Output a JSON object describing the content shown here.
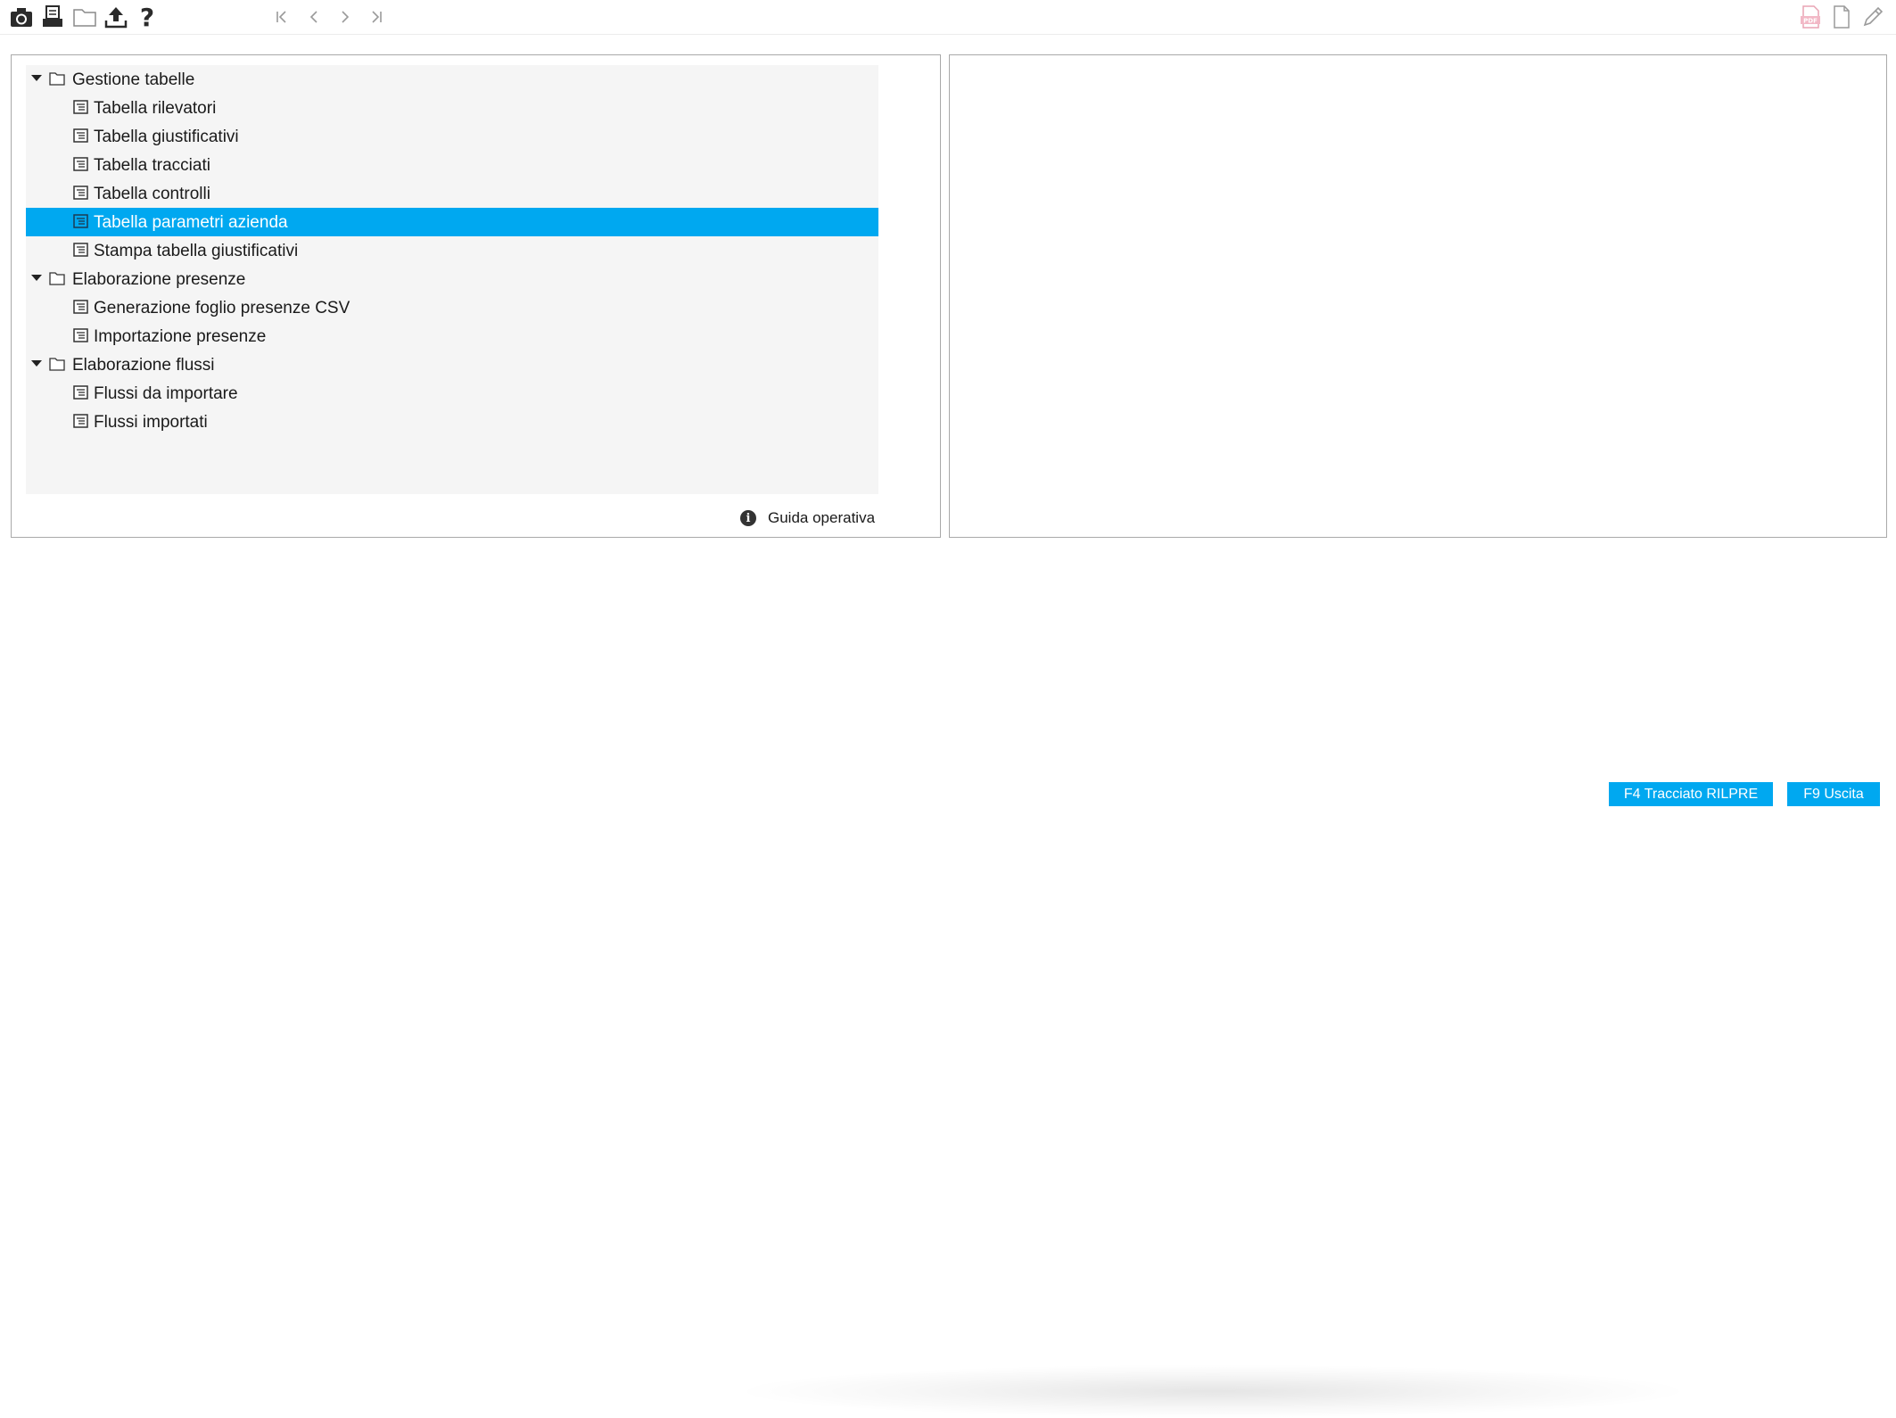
{
  "toolbar": {
    "left_icons": [
      "camera-icon",
      "printer-icon",
      "folder-icon",
      "upload-icon",
      "help-icon"
    ],
    "nav_icons": [
      "first-page-icon",
      "previous-icon",
      "next-icon",
      "last-page-icon"
    ],
    "right_icons": [
      "pdf-icon",
      "document-icon",
      "pencil-icon"
    ]
  },
  "tree": {
    "groups": [
      {
        "label": "Gestione tabelle",
        "items": [
          "Tabella rilevatori",
          "Tabella giustificativi",
          "Tabella tracciati",
          "Tabella controlli",
          "Tabella parametri azienda",
          "Stampa tabella giustificativi"
        ]
      },
      {
        "label": "Elaborazione presenze",
        "items": [
          "Generazione foglio presenze CSV",
          "Importazione presenze"
        ]
      },
      {
        "label": "Elaborazione flussi",
        "items": [
          "Flussi da importare",
          "Flussi importati"
        ]
      }
    ],
    "selected": "Tabella parametri azienda"
  },
  "guide": {
    "label": "Guida operativa"
  },
  "buttons": {
    "f4_label": "F4 Tracciato RILPRE",
    "f9_label": "F9 Uscita"
  },
  "colors": {
    "accent": "#00a8f0",
    "tree_bg": "#f5f5f5",
    "border": "#a9a9a9"
  }
}
